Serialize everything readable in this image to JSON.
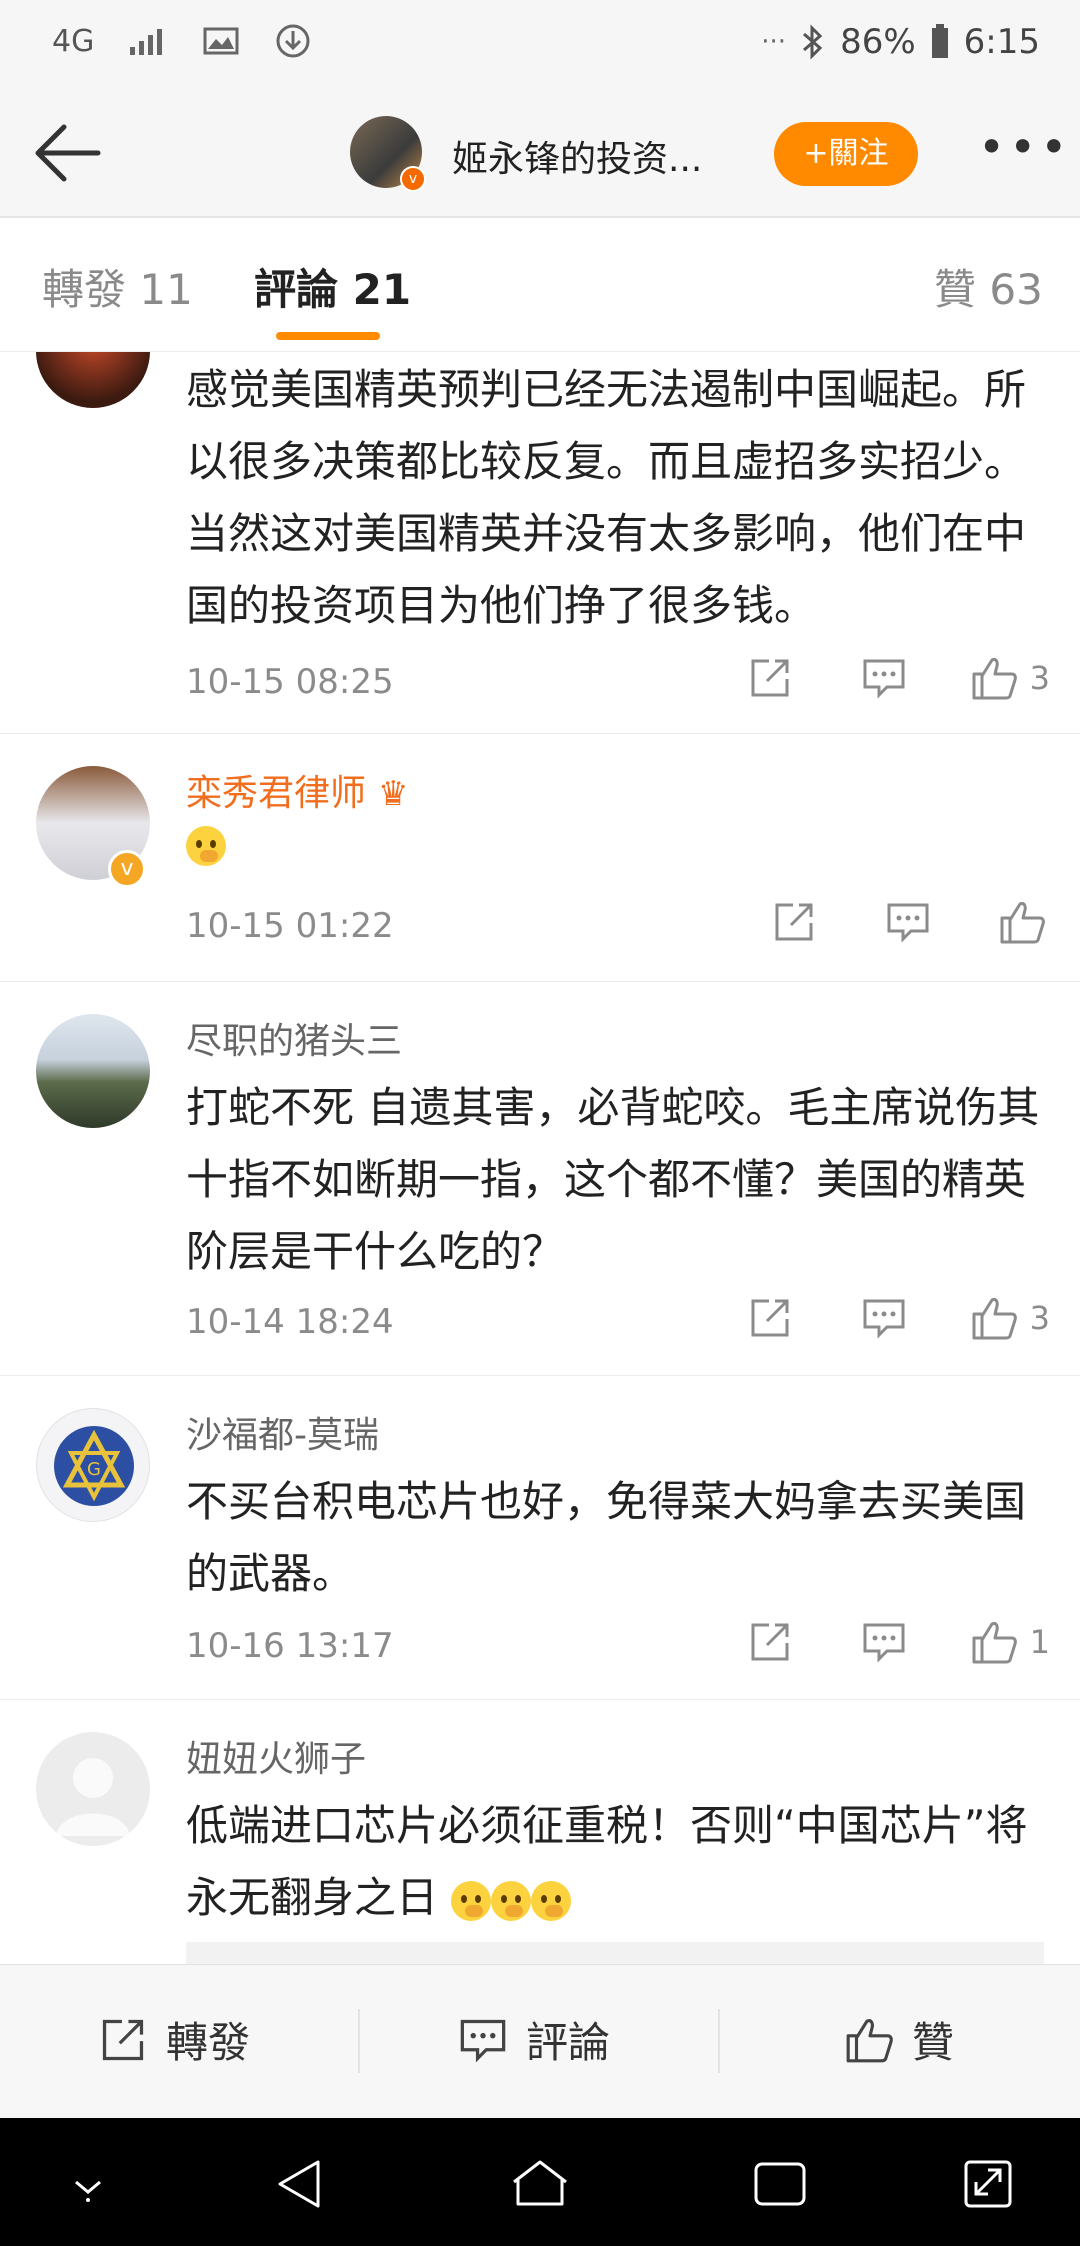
{
  "status_bar": {
    "network": "4G",
    "battery": "86%",
    "time": "6:15",
    "more": "···"
  },
  "header": {
    "title": "姬永锋的投资...",
    "follow_label": "+關注"
  },
  "tabs": {
    "repost": "轉發 11",
    "comment": "評論 21",
    "like": "贊 63"
  },
  "comments": [
    {
      "name": "",
      "text": "感觉美国精英预判已经无法遏制中国崛起。所以很多决策都比较反复。而且虚招多实招少。当然这对美国精英并没有太多影响，他们在中国的投资项目为他们挣了很多钱。",
      "time": "10-15 08:25",
      "likes": "3"
    },
    {
      "name": "栾秀君律师",
      "text": "",
      "time": "10-15 01:22",
      "likes": ""
    },
    {
      "name": "尽职的猪头三",
      "text": "打蛇不死 自遗其害，必背蛇咬。毛主席说伤其十指不如断期一指，这个都不懂？美国的精英阶层是干什么吃的？",
      "time": "10-14 18:24",
      "likes": "3"
    },
    {
      "name": "沙福都-莫瑞",
      "text": "不买台积电芯片也好，免得菜大妈拿去买美国的武器。",
      "time": "10-16 13:17",
      "likes": "1"
    },
    {
      "name": "妞妞火狮子",
      "text": "低端进口芯片必须征重税！否则“中国芯片”将永无翻身之日",
      "time": "",
      "likes": ""
    }
  ],
  "bottom_bar": {
    "repost": "轉發",
    "comment": "評論",
    "like": "贊"
  },
  "colors": {
    "accent": "#ff8a00",
    "vip_name": "#f06e1e"
  }
}
